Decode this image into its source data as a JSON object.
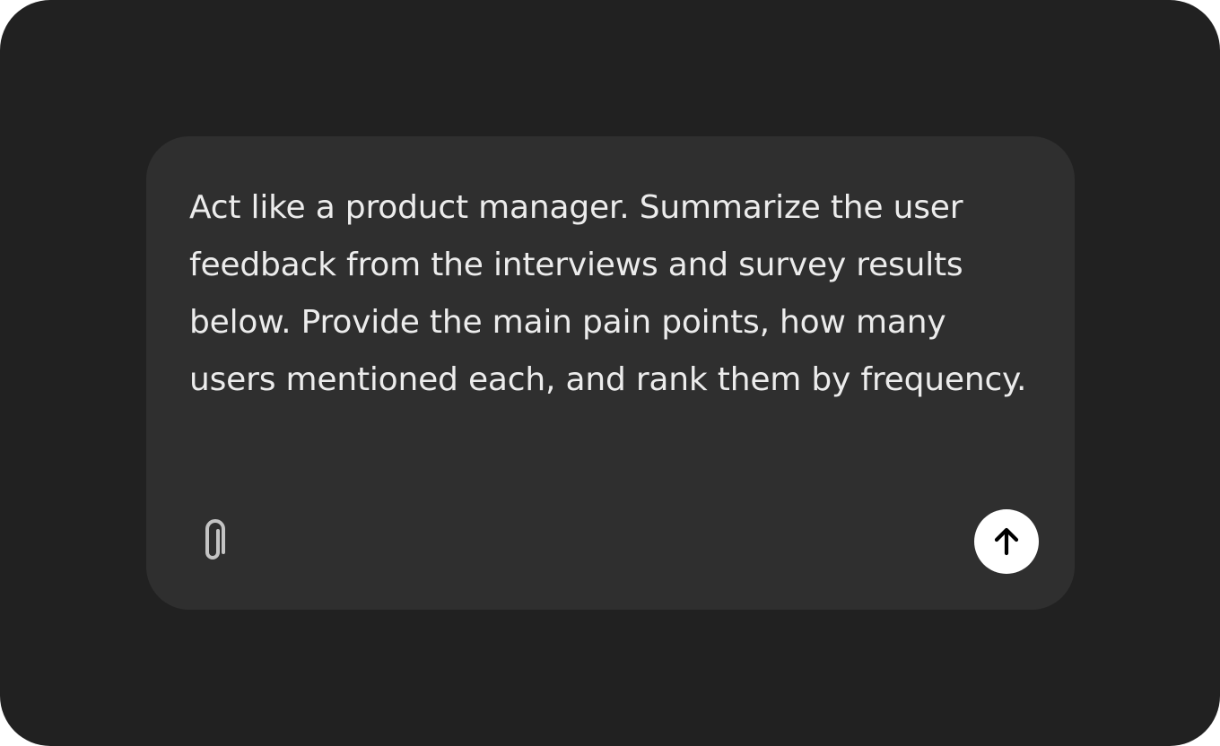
{
  "composer": {
    "prompt_text": "Act like a product manager. Summarize the user feedback from the interviews and survey results below. Provide the main pain points, how many users mentioned each, and rank them by frequency.",
    "attach_icon": "paperclip-icon",
    "send_icon": "arrow-up-icon"
  },
  "colors": {
    "page_background": "#212121",
    "composer_background": "#2f2f2f",
    "text": "#ececec",
    "send_button": "#ffffff"
  }
}
